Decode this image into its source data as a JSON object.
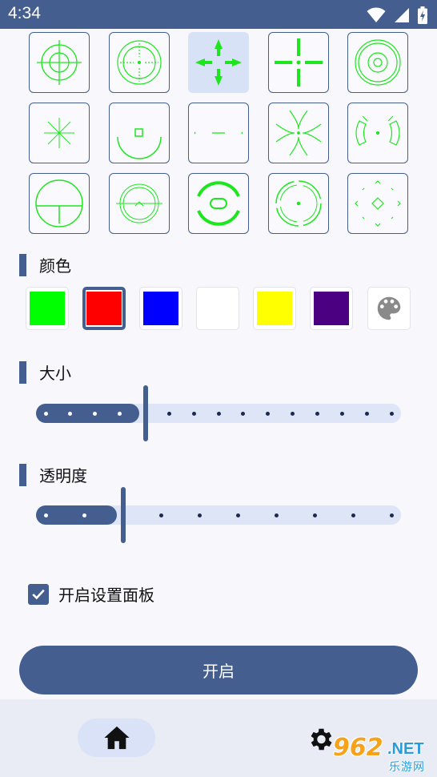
{
  "status_bar": {
    "time": "4:34",
    "icons": [
      "wifi-icon",
      "signal-icon",
      "battery-charging-icon"
    ]
  },
  "crosshair_grid": {
    "columns": 5,
    "rows": 3,
    "crosshair_color": "#1ee61e",
    "selected_index": 2,
    "items": [
      "crosshair-scope-icon",
      "crosshair-circle-dot-icon",
      "crosshair-arrows-icon",
      "crosshair-plus-icon",
      "crosshair-concentric-icon",
      "crosshair-star-icon",
      "crosshair-u-square-icon",
      "crosshair-line-icon",
      "crosshair-curves-icon",
      "crosshair-brackets-icon",
      "crosshair-circle-line-icon",
      "crosshair-ring-caret-icon",
      "crosshair-bold-ring-icon",
      "crosshair-dashed-ring-icon",
      "crosshair-diamond-icon"
    ]
  },
  "color_section": {
    "title": "颜色",
    "swatches": [
      "#00ff00",
      "#ff0000",
      "#0000ff",
      "#ffffff",
      "#ffff00",
      "#4b0082"
    ],
    "selected_index": 1,
    "custom_icon": "palette-icon"
  },
  "size_section": {
    "title": "大小",
    "value": 0.3,
    "steps": 15
  },
  "opacity_section": {
    "title": "透明度",
    "value": 0.24,
    "steps": 10
  },
  "settings_panel_checkbox": {
    "label": "开启设置面板",
    "checked": true
  },
  "start_button": {
    "label": "开启"
  },
  "bottom_nav": {
    "items": [
      "home-icon",
      "settings-gear-icon"
    ],
    "active": "home-icon"
  },
  "watermark": {
    "number": "962",
    "domain": ".NET",
    "caption": "乐游网"
  }
}
